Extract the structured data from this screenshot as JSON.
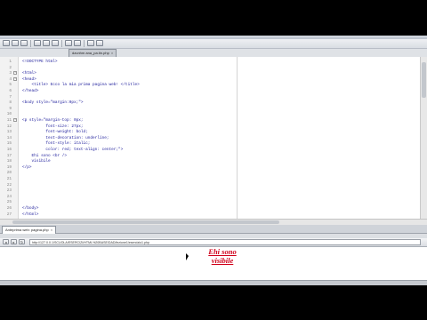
{
  "editor_tab": {
    "title": "dzunhm ana_pa.tin.php",
    "close": "×"
  },
  "code_lines": [
    {
      "n": "1",
      "fold": "",
      "text": "<!DOCTYPE html>"
    },
    {
      "n": "2",
      "fold": "",
      "text": ""
    },
    {
      "n": "3",
      "fold": "-",
      "text": "<html>"
    },
    {
      "n": "4",
      "fold": "-",
      "text": "<head>"
    },
    {
      "n": "5",
      "fold": "",
      "text": "    <title> Ecco la mia prima pagina web! </title>"
    },
    {
      "n": "6",
      "fold": "",
      "text": "</head>"
    },
    {
      "n": "7",
      "fold": "",
      "text": ""
    },
    {
      "n": "8",
      "fold": "",
      "text": "<body style=\"margin:0px;\">"
    },
    {
      "n": "9",
      "fold": "",
      "text": ""
    },
    {
      "n": "10",
      "fold": "",
      "text": ""
    },
    {
      "n": "11",
      "fold": "-",
      "text": "<p style=\"margin-top: 0px;"
    },
    {
      "n": "12",
      "fold": "",
      "text": "          font-size: 27px;"
    },
    {
      "n": "13",
      "fold": "",
      "text": "          font-weight: bold;"
    },
    {
      "n": "14",
      "fold": "",
      "text": "          text-decoration: underline;"
    },
    {
      "n": "15",
      "fold": "",
      "text": "          font-style: italic;"
    },
    {
      "n": "16",
      "fold": "",
      "text": "          color: red; text-align: center;\">"
    },
    {
      "n": "17",
      "fold": "",
      "text": "    Ehi sono <br />"
    },
    {
      "n": "18",
      "fold": "",
      "text": "    visibile"
    },
    {
      "n": "19",
      "fold": "",
      "text": "</p>"
    },
    {
      "n": "20",
      "fold": "",
      "text": ""
    },
    {
      "n": "21",
      "fold": "",
      "text": ""
    },
    {
      "n": "22",
      "fold": "",
      "text": ""
    },
    {
      "n": "23",
      "fold": "",
      "text": ""
    },
    {
      "n": "24",
      "fold": "",
      "text": ""
    },
    {
      "n": "25",
      "fold": "",
      "text": ""
    },
    {
      "n": "26",
      "fold": "",
      "text": "</body>"
    },
    {
      "n": "27",
      "fold": "",
      "text": "</html>"
    }
  ],
  "preview_tab": {
    "title": "Anteprima web: pagina.php",
    "close": "×"
  },
  "preview_nav": {
    "back": "◂",
    "forward": "▸",
    "refresh": "↻"
  },
  "address_url": "http://127.0.0.1/SCUOLA/ESERCIZI/HTML%20BASE/DAD/lezione1/esercizio1.php",
  "preview_content": {
    "line1": "Ehi sono",
    "line2": "visibile"
  },
  "colors": {
    "code_text": "#1b1b9a",
    "preview_text": "#d0001a",
    "editor_bg": "#ffffff"
  },
  "icons": [
    "new-file-icon",
    "open-icon",
    "save-icon",
    "cut-icon",
    "copy-icon",
    "paste-icon",
    "undo-icon",
    "redo-icon",
    "find-icon",
    "preview-icon"
  ]
}
